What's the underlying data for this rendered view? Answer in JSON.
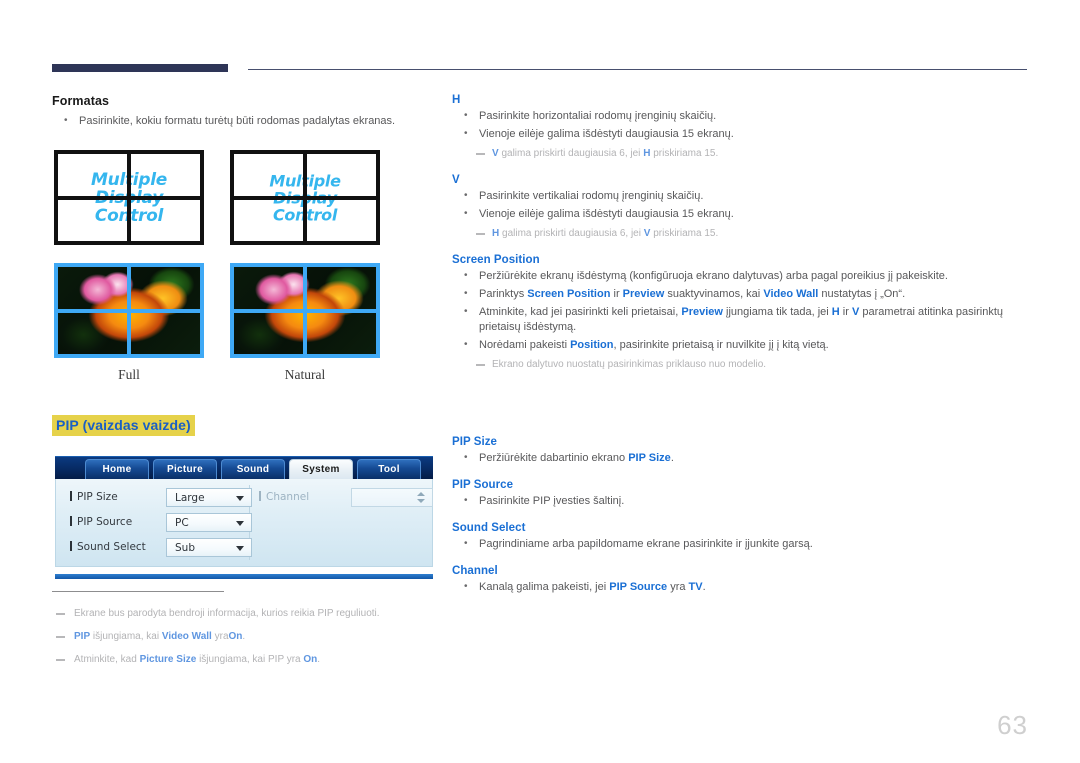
{
  "page": {
    "number": "63",
    "highlight_color": "#e6d24a",
    "accent_blue": "#1a6fd4",
    "rule_color": "#2e3557"
  },
  "left": {
    "format_heading": "Formatas",
    "format_bullet": "Pasirinkite, kokiu formatu turėtų būti rodomas padalytas ekranas.",
    "panels": [
      {
        "screen_text": "Multiple Display Control",
        "caption": "Full"
      },
      {
        "screen_text": "Multiple Display Control",
        "caption": "Natural"
      }
    ],
    "pip_heading": "PIP (vaizdas vaizde)",
    "osd": {
      "tabs": [
        "Home",
        "Picture",
        "Sound",
        "System",
        "Tool"
      ],
      "active_tab": "System",
      "rows": [
        {
          "label": "PIP Size",
          "value": "Large"
        },
        {
          "label": "PIP Source",
          "value": "PC"
        },
        {
          "label": "Sound Select",
          "value": "Sub"
        }
      ],
      "channel": {
        "label": "Channel",
        "value": ""
      }
    },
    "footnotes": [
      "Ekrane bus parodyta bendroji informacija, kurios reikia PIP reguliuoti.",
      "PIP išjungiama, kai Video Wall yra On.",
      "Atminkite, kad Picture Size išjungiama, kai PIP yra On."
    ]
  },
  "right": {
    "sections": [
      {
        "heading": "H",
        "bullets": [
          "Pasirinkite horizontaliai rodomų įrenginių skaičių.",
          "Vienoje eilėje galima išdėstyti daugiausia 15 ekranų."
        ],
        "note": "V galima priskirti daugiausia 6, jei H priskiriama 15."
      },
      {
        "heading": "V",
        "bullets": [
          "Pasirinkite vertikaliai rodomų įrenginių skaičių.",
          "Vienoje eilėje galima išdėstyti daugiausia 15 ekranų."
        ],
        "note": "H galima priskirti daugiausia 6, jei V priskiriama 15."
      },
      {
        "heading": "Screen Position",
        "bullets": [
          "Peržiūrėkite ekranų išdėstymą (konfigūruoja ekrano dalytuvas) arba pagal poreikius jį pakeiskite.",
          "Parinktys Screen Position ir Preview suaktyvinamos, kai Video Wall nustatytas į „On“.",
          "Atminkite, kad jei pasirinkti keli prietaisai, Preview įjungiama tik tada, jei H ir V parametrai atitinka pasirinktų prietaisų išdėstymą.",
          "Norėdami pakeisti Position, pasirinkite prietaisą ir nuvilkite jį į kitą vietą."
        ],
        "note": "Ekrano dalytuvo nuostatų pasirinkimas priklauso nuo modelio."
      },
      {
        "heading": "PIP Size",
        "bullets": [
          "Peržiūrėkite dabartinio ekrano PIP Size."
        ],
        "note": ""
      },
      {
        "heading": "PIP Source",
        "bullets": [
          "Pasirinkite PIP įvesties šaltinį."
        ],
        "note": ""
      },
      {
        "heading": "Sound Select",
        "bullets": [
          "Pagrindiniame arba papildomame ekrane pasirinkite ir įjunkite garsą."
        ],
        "note": ""
      },
      {
        "heading": "Channel",
        "bullets": [
          "Kanalą galima pakeisti, jei PIP Source yra TV."
        ],
        "note": ""
      }
    ]
  }
}
